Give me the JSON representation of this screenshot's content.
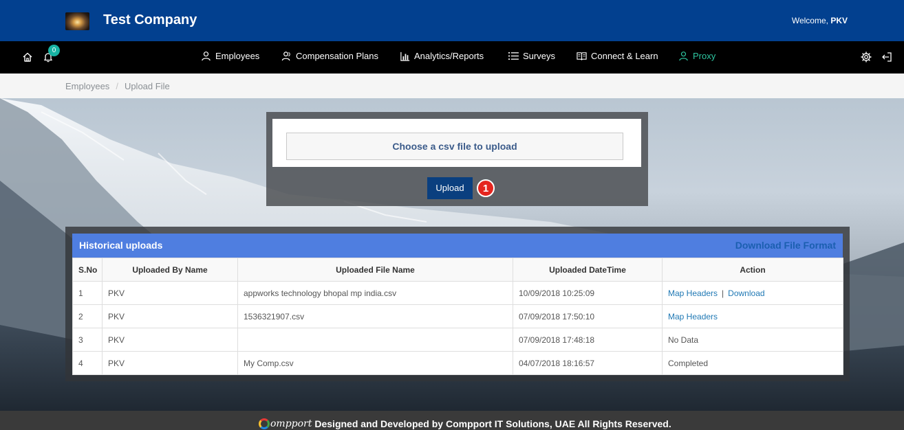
{
  "header": {
    "company_name": "Test Company",
    "welcome_prefix": "Welcome,",
    "user": "PKV"
  },
  "navbar": {
    "notification_count": "0",
    "items": [
      {
        "label": "Employees",
        "icon": "user-icon"
      },
      {
        "label": "Compensation Plans",
        "icon": "users-icon"
      },
      {
        "label": "Analytics/Reports",
        "icon": "bar-chart-icon"
      },
      {
        "label": "Surveys",
        "icon": "list-icon"
      },
      {
        "label": "Connect & Learn",
        "icon": "book-icon"
      },
      {
        "label": "Proxy",
        "icon": "user-icon",
        "active": true
      }
    ],
    "active_color": "#2ec7a1"
  },
  "breadcrumb": [
    "Employees",
    "Upload File"
  ],
  "upload": {
    "file_prompt": "Choose a csv file to upload",
    "button_label": "Upload",
    "step_number": "1"
  },
  "history": {
    "title": "Historical uploads",
    "download_format_label": "Download File Format",
    "columns": [
      "S.No",
      "Uploaded By Name",
      "Uploaded File Name",
      "Uploaded DateTime",
      "Action"
    ],
    "rows": [
      {
        "sno": "1",
        "by": "PKV",
        "file": "appworks technology bhopal mp india.csv",
        "datetime": "10/09/2018 10:25:09",
        "action_1": "Map Headers",
        "action_sep": "|",
        "action_2": "Download"
      },
      {
        "sno": "2",
        "by": "PKV",
        "file": "1536321907.csv",
        "datetime": "07/09/2018 17:50:10",
        "action_1": "Map Headers"
      },
      {
        "sno": "3",
        "by": "PKV",
        "file": "",
        "datetime": "07/09/2018 17:48:18",
        "status": "No Data"
      },
      {
        "sno": "4",
        "by": "PKV",
        "file": "My Comp.csv",
        "datetime": "04/07/2018 18:16:57",
        "status": "Completed"
      }
    ]
  },
  "footer": {
    "logo_text": "ompport",
    "text": "Designed and Developed by Compport IT Solutions, UAE  All Rights Reserved."
  },
  "colors": {
    "header_bg": "#02408f",
    "nav_bg": "#000000",
    "accent": "#4f7ee0",
    "button": "#0a3f7f",
    "badge": "#18b3a3",
    "step": "#e5251f"
  }
}
